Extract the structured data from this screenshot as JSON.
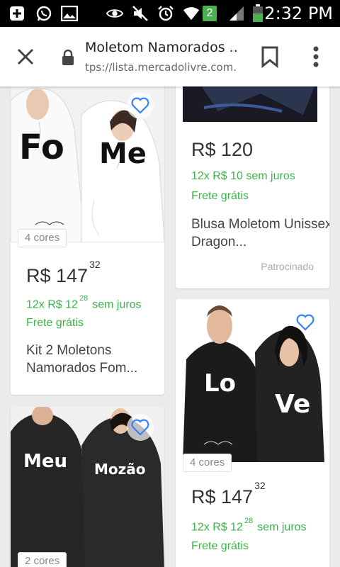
{
  "status_bar": {
    "time": "2:32 PM",
    "notification_count": "2",
    "icons": [
      "add-box-icon",
      "whatsapp-icon",
      "gallery-icon",
      "eye-icon",
      "mute-icon",
      "alarm-icon",
      "wifi-icon",
      "signal-icon",
      "battery-icon"
    ]
  },
  "tab": {
    "title": "Moletom Namorados ...",
    "url": "tps://lista.mercadolivre.com.b",
    "icons": [
      "close-icon",
      "lock-icon",
      "bookmark-icon",
      "more-vert-icon"
    ]
  },
  "products": [
    {
      "print_left": "Fo",
      "print_right": "Me",
      "colors": "4 cores",
      "price_int": "R$ 147",
      "price_cents": "32",
      "install_prefix": "12x R$ 12",
      "install_cents": "28",
      "install_suffix": "sem juros",
      "shipping": "Frete grátis",
      "title": "Kit 2 Moletons Namorados Fom..."
    },
    {
      "price_int": "R$ 120",
      "installments": "12x R$ 10 sem juros",
      "shipping": "Frete grátis",
      "title": "Blusa Moletom Unissex Dragon...",
      "sponsored": "Patrocinado"
    },
    {
      "print_left": "Lo",
      "print_right": "Ve",
      "colors": "4 cores",
      "price_int": "R$ 147",
      "price_cents": "32",
      "install_prefix": "12x R$ 12",
      "install_cents": "28",
      "install_suffix": "sem juros",
      "shipping": "Frete grátis"
    },
    {
      "print_left": "Meu",
      "print_right": "Mozão",
      "colors": "2 cores"
    }
  ],
  "colors": {
    "status_bar": "#000000",
    "green_text": "#39b54a",
    "heart": "#3483fa",
    "page_bg": "#ebebeb"
  }
}
